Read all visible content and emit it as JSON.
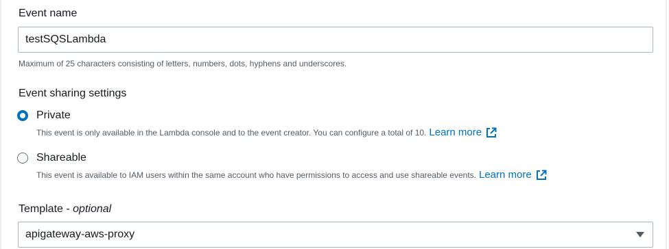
{
  "event_name": {
    "label": "Event name",
    "value": "testSQSLambda",
    "hint": "Maximum of 25 characters consisting of letters, numbers, dots, hyphens and underscores."
  },
  "sharing": {
    "label": "Event sharing settings",
    "options": [
      {
        "label": "Private",
        "checked": true,
        "description": "This event is only available in the Lambda console and to the event creator. You can configure a total of 10.",
        "link": "Learn more",
        "link_icon": "external-link-icon"
      },
      {
        "label": "Shareable",
        "checked": false,
        "description": "This event is available to IAM users within the same account who have permissions to access and use shareable events.",
        "link": "Learn more",
        "link_icon": "external-link-icon"
      }
    ]
  },
  "template": {
    "label": "Template - ",
    "optional": "optional",
    "value": "apigateway-aws-proxy",
    "icon": "caret-down-icon"
  },
  "colors": {
    "accent": "#0073bb",
    "text": "#16191f",
    "muted": "#545b64",
    "border": "#aab7b8"
  }
}
